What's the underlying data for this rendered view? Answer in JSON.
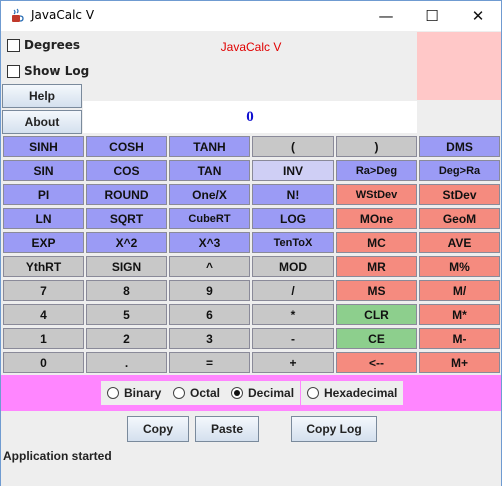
{
  "window": {
    "title": "JavaCalc V",
    "minimize_glyph": "—",
    "maximize_glyph": "☐",
    "close_glyph": "✕",
    "icon": "java-cup-icon"
  },
  "options": {
    "degrees_label": "Degrees",
    "degrees_checked": false,
    "show_log_label": "Show Log",
    "show_log_checked": false
  },
  "brand": "JavaCalc V",
  "buttons": {
    "help": "Help",
    "about": "About"
  },
  "display": {
    "value": "0"
  },
  "colors": {
    "blue": "#9b9bf5",
    "gray": "#c8c8c8",
    "red": "#f58b7f",
    "green": "#8dcf8d",
    "lilac": "#cfcff5",
    "radix_bar": "#ff86ff",
    "readout": "#1010d0",
    "brand": "#e00000"
  },
  "keys": [
    [
      [
        "SINH",
        "blue"
      ],
      [
        "COSH",
        "blue"
      ],
      [
        "TANH",
        "blue"
      ],
      [
        "(",
        "gray"
      ],
      [
        ")",
        "gray"
      ],
      [
        "DMS",
        "blue"
      ]
    ],
    [
      [
        "SIN",
        "blue"
      ],
      [
        "COS",
        "blue"
      ],
      [
        "TAN",
        "blue"
      ],
      [
        "INV",
        "lilac"
      ],
      [
        "Ra>Deg",
        "blue"
      ],
      [
        "Deg>Ra",
        "blue"
      ]
    ],
    [
      [
        "PI",
        "blue"
      ],
      [
        "ROUND",
        "blue"
      ],
      [
        "One/X",
        "blue"
      ],
      [
        "N!",
        "blue"
      ],
      [
        "WStDev",
        "red"
      ],
      [
        "StDev",
        "red"
      ]
    ],
    [
      [
        "LN",
        "blue"
      ],
      [
        "SQRT",
        "blue"
      ],
      [
        "CubeRT",
        "blue"
      ],
      [
        "LOG",
        "blue"
      ],
      [
        "MOne",
        "red"
      ],
      [
        "GeoM",
        "red"
      ]
    ],
    [
      [
        "EXP",
        "blue"
      ],
      [
        "X^2",
        "blue"
      ],
      [
        "X^3",
        "blue"
      ],
      [
        "TenToX",
        "blue"
      ],
      [
        "MC",
        "red"
      ],
      [
        "AVE",
        "red"
      ]
    ],
    [
      [
        "YthRT",
        "gray"
      ],
      [
        "SIGN",
        "gray"
      ],
      [
        "^",
        "gray"
      ],
      [
        "MOD",
        "gray"
      ],
      [
        "MR",
        "red"
      ],
      [
        "M%",
        "red"
      ]
    ],
    [
      [
        "7",
        "gray"
      ],
      [
        "8",
        "gray"
      ],
      [
        "9",
        "gray"
      ],
      [
        "/",
        "gray"
      ],
      [
        "MS",
        "red"
      ],
      [
        "M/",
        "red"
      ]
    ],
    [
      [
        "4",
        "gray"
      ],
      [
        "5",
        "gray"
      ],
      [
        "6",
        "gray"
      ],
      [
        "*",
        "gray"
      ],
      [
        "CLR",
        "green"
      ],
      [
        "M*",
        "red"
      ]
    ],
    [
      [
        "1",
        "gray"
      ],
      [
        "2",
        "gray"
      ],
      [
        "3",
        "gray"
      ],
      [
        "-",
        "gray"
      ],
      [
        "CE",
        "green"
      ],
      [
        "M-",
        "red"
      ]
    ],
    [
      [
        "0",
        "gray"
      ],
      [
        ".",
        "gray"
      ],
      [
        "=",
        "gray"
      ],
      [
        "+",
        "gray"
      ],
      [
        "<--",
        "red"
      ],
      [
        "M+",
        "red"
      ]
    ]
  ],
  "radix": {
    "options": [
      "Binary",
      "Octal",
      "Decimal",
      "Hexadecimal"
    ],
    "selected": "Decimal"
  },
  "actions": {
    "copy": "Copy",
    "paste": "Paste",
    "copy_log": "Copy Log"
  },
  "status": "Application started"
}
